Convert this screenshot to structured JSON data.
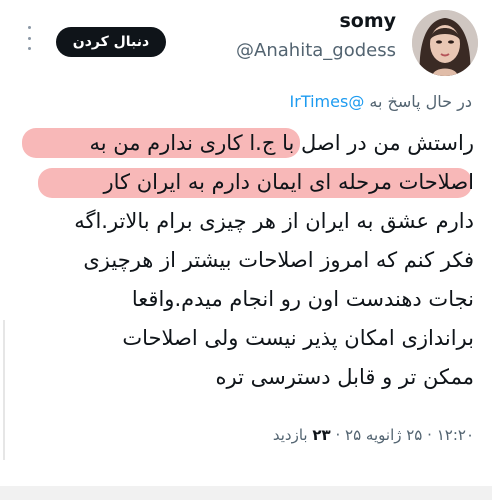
{
  "header": {
    "display_name": "somy",
    "username": "@Anahita_godess",
    "follow_label": "دنبال کردن",
    "more_icon": "more-vertical-icon"
  },
  "reply": {
    "prefix": "در حال پاسخ به",
    "mention": "@IrTimes"
  },
  "tweet": {
    "lines": [
      "راستش من در اصل با ج.ا کاری ندارم من به",
      "اصلاحات مرحله ای ایمان دارم به ایران کار",
      "دارم عشق به ایران از هر چیزی برام بالاتر.اگه",
      "فکر کنم که امروز اصلاحات بیشتر از هرچیزی",
      "نجات دهندست اون رو انجام میدم.واقعا",
      "براندازی امکان پذیر نیست ولی اصلاحات",
      "ممکن تر و قابل دسترسی تره"
    ],
    "highlight_color": "#f48c8c"
  },
  "meta": {
    "time": "۱۲:۲۰",
    "date": "۲۵ ژانویه ۲۵",
    "views_count": "۲۳",
    "views_label": "بازدید",
    "separator": "·"
  }
}
